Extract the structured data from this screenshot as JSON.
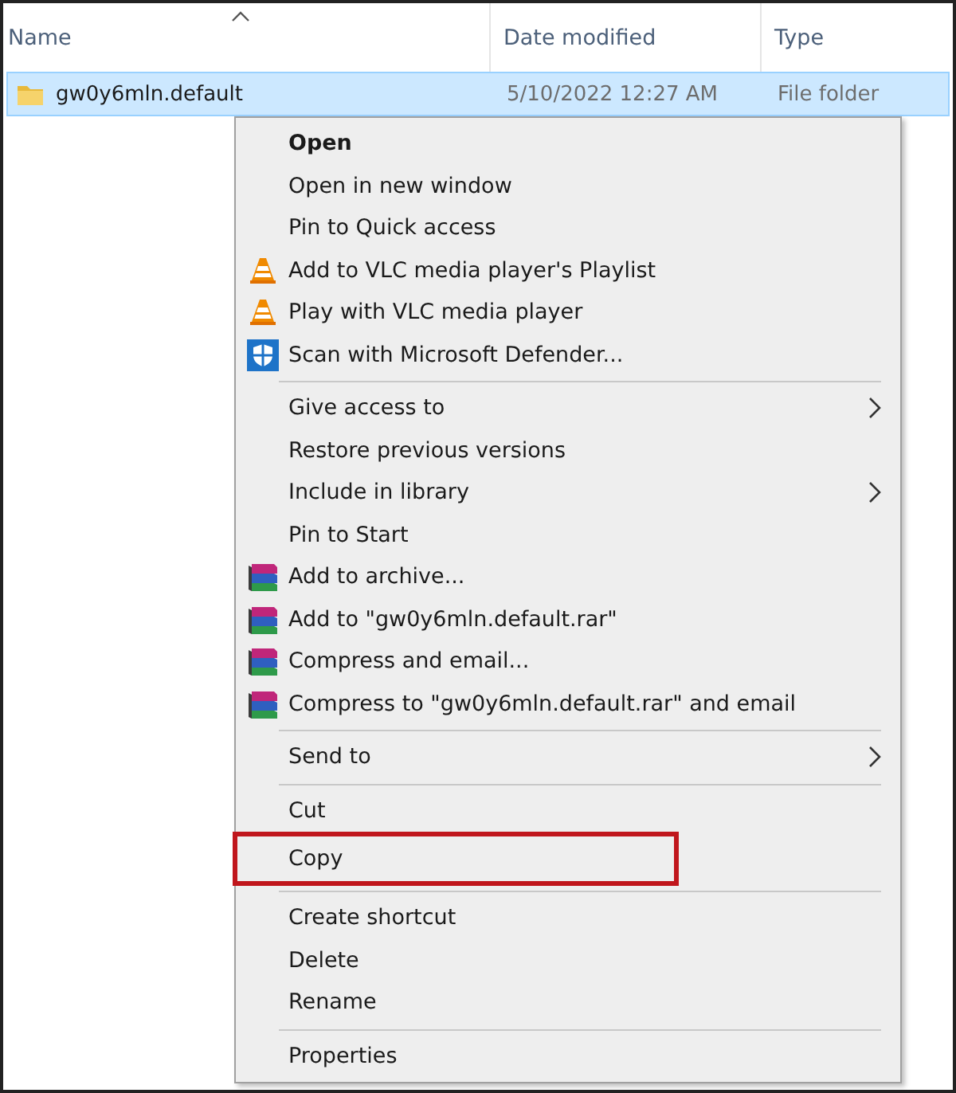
{
  "columns": [
    {
      "label": "Name",
      "sorted": true
    },
    {
      "label": "Date modified",
      "sorted": false
    },
    {
      "label": "Type",
      "sorted": false
    }
  ],
  "row": {
    "name": "gw0y6mln.default",
    "date": "5/10/2022 12:27 AM",
    "type": "File folder",
    "selected": true
  },
  "menu": [
    [
      {
        "label": "Open",
        "default": true,
        "kind": "plain",
        "submenu": false,
        "highlighted": false
      },
      {
        "label": "Open in new window",
        "default": false,
        "kind": "plain",
        "submenu": false,
        "highlighted": false
      },
      {
        "label": "Pin to Quick access",
        "default": false,
        "kind": "plain",
        "submenu": false,
        "highlighted": false
      },
      {
        "label": "Add to VLC media player's Playlist",
        "default": false,
        "kind": "cone",
        "submenu": false,
        "highlighted": false
      },
      {
        "label": "Play with VLC media player",
        "default": false,
        "kind": "cone",
        "submenu": false,
        "highlighted": false
      },
      {
        "label": "Scan with Microsoft Defender...",
        "default": false,
        "kind": "shield",
        "submenu": false,
        "highlighted": false
      }
    ],
    [
      {
        "label": "Give access to",
        "default": false,
        "kind": "plain",
        "submenu": true,
        "highlighted": false
      },
      {
        "label": "Restore previous versions",
        "default": false,
        "kind": "plain",
        "submenu": false,
        "highlighted": false
      },
      {
        "label": "Include in library",
        "default": false,
        "kind": "plain",
        "submenu": true,
        "highlighted": false
      },
      {
        "label": "Pin to Start",
        "default": false,
        "kind": "plain",
        "submenu": false,
        "highlighted": false
      },
      {
        "label": "Add to archive...",
        "default": false,
        "kind": "books",
        "submenu": false,
        "highlighted": false
      },
      {
        "label": "Add to \"gw0y6mln.default.rar\"",
        "default": false,
        "kind": "books",
        "submenu": false,
        "highlighted": false
      },
      {
        "label": "Compress and email...",
        "default": false,
        "kind": "books",
        "submenu": false,
        "highlighted": false
      },
      {
        "label": "Compress to \"gw0y6mln.default.rar\" and email",
        "default": false,
        "kind": "books",
        "submenu": false,
        "highlighted": false
      }
    ],
    [
      {
        "label": "Send to",
        "default": false,
        "kind": "plain",
        "submenu": true,
        "highlighted": false
      }
    ],
    [
      {
        "label": "Cut",
        "default": false,
        "kind": "plain",
        "submenu": false,
        "highlighted": false
      },
      {
        "label": "Copy",
        "default": false,
        "kind": "plain",
        "submenu": false,
        "highlighted": true
      }
    ],
    [
      {
        "label": "Create shortcut",
        "default": false,
        "kind": "plain",
        "submenu": false,
        "highlighted": false
      },
      {
        "label": "Delete",
        "default": false,
        "kind": "plain",
        "submenu": false,
        "highlighted": false
      },
      {
        "label": "Rename",
        "default": false,
        "kind": "plain",
        "submenu": false,
        "highlighted": false
      }
    ],
    [
      {
        "label": "Properties",
        "default": false,
        "kind": "plain",
        "submenu": false,
        "highlighted": false
      }
    ]
  ]
}
